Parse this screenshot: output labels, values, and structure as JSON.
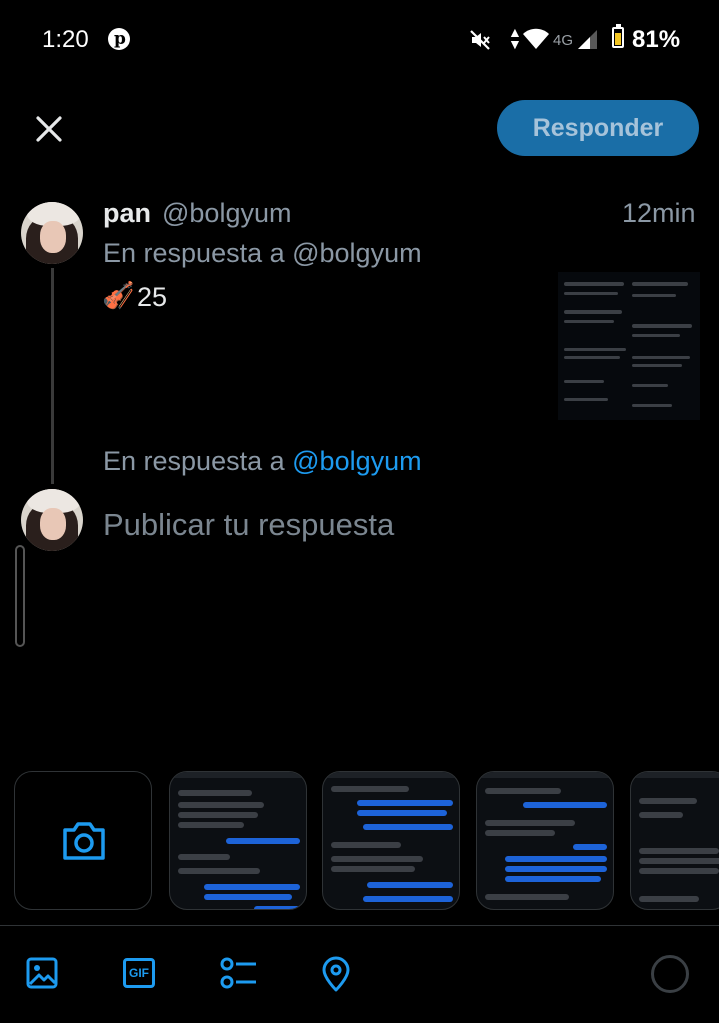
{
  "status_bar": {
    "time": "1:20",
    "network": "4G",
    "battery": "81%",
    "battery_level": 0.81,
    "icons": [
      "pinterest-icon",
      "mute-icon",
      "data-arrows-icon",
      "wifi-icon",
      "signal-icon",
      "battery-icon"
    ]
  },
  "top_bar": {
    "close_icon": "close-icon",
    "reply_label": "Responder"
  },
  "tweet": {
    "name": "pan",
    "handle": "@bolgyum",
    "time": "12min",
    "reply_context": "En respuesta a @bolgyum",
    "emoji": "🎻",
    "text": "25"
  },
  "compose": {
    "reply_to_prefix": "En respuesta a",
    "reply_to_handle": "@bolgyum",
    "placeholder": "Publicar tu respuesta"
  },
  "media_strip": {
    "camera_icon": "camera-icon"
  },
  "toolbar": {
    "icons": [
      "image-icon",
      "gif-icon",
      "poll-icon",
      "location-icon"
    ],
    "gif_label": "GIF"
  },
  "colors": {
    "accent": "#1d9bf0",
    "reply_button_bg": "#1a6ea7",
    "background": "#000000",
    "secondary_text": "#8b98a5"
  }
}
